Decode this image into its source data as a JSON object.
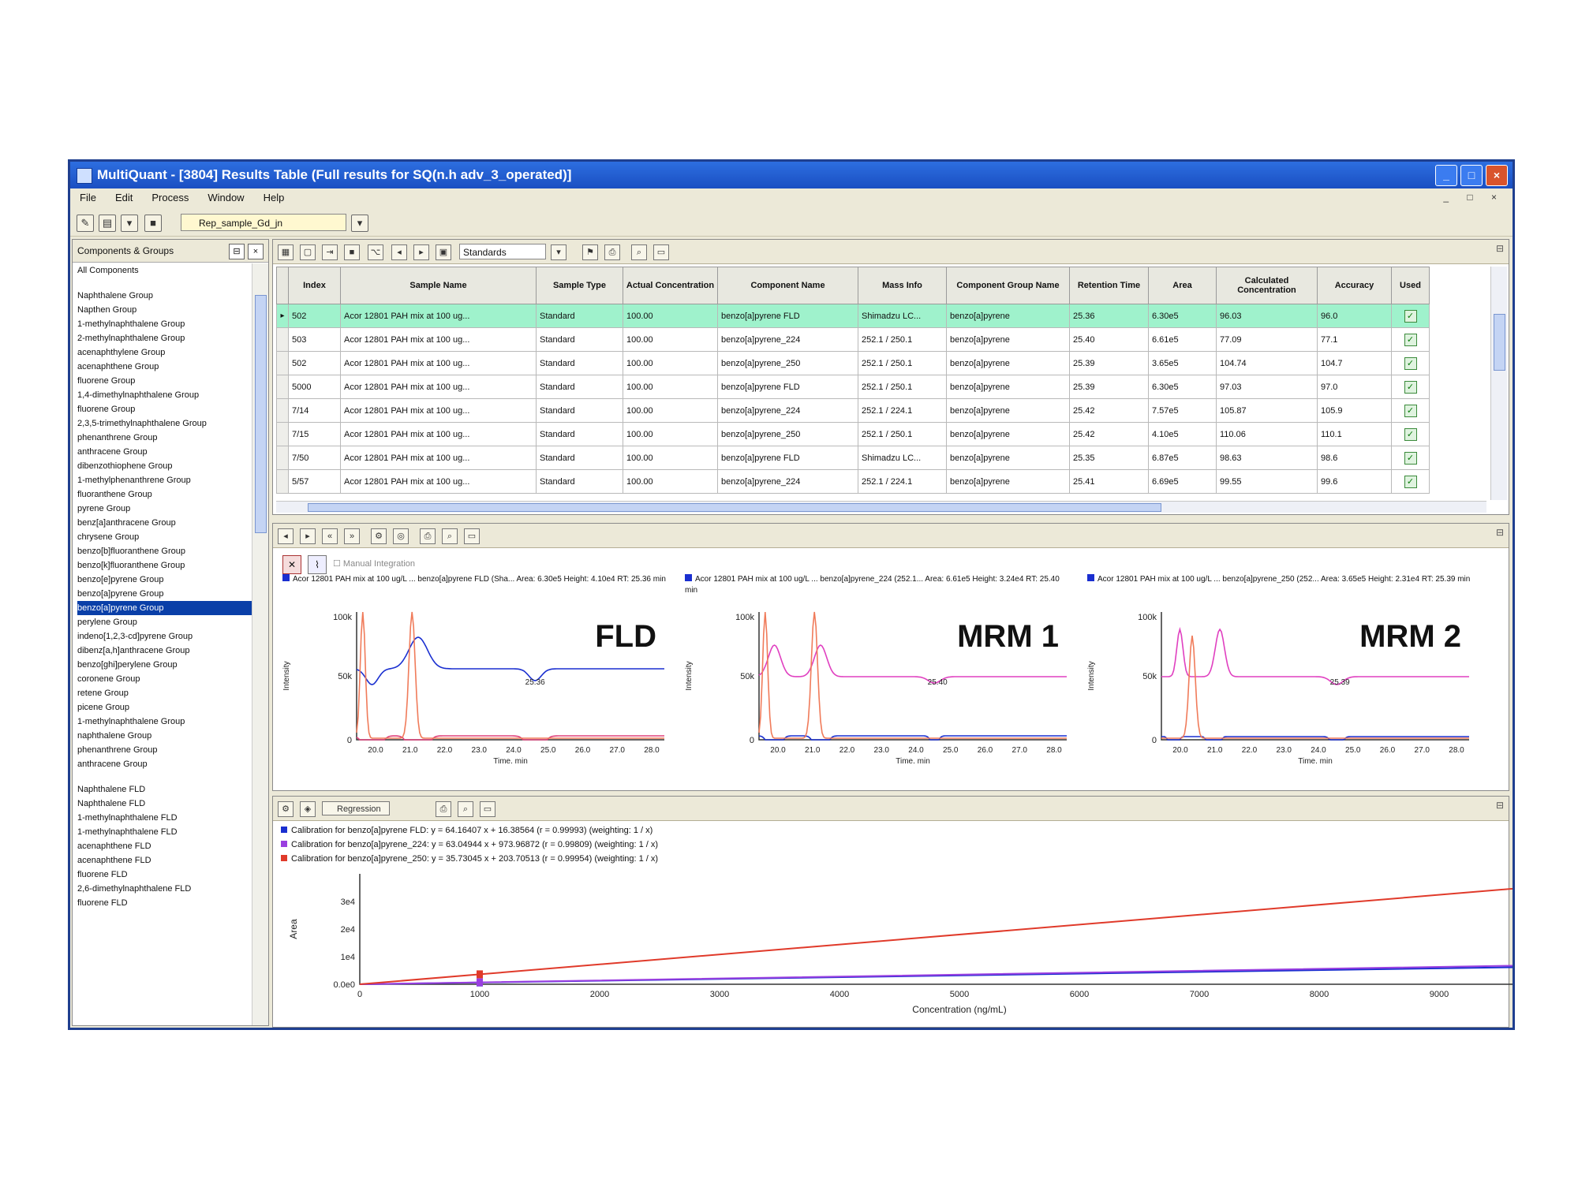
{
  "window": {
    "title": "MultiQuant - [3804] Results Table (Full results for SQ(n.h adv_3_operated)]",
    "min": "_",
    "max": "□",
    "close": "×"
  },
  "menu": [
    "File",
    "Edit",
    "Process",
    "Window",
    "Help"
  ],
  "toolbar": {
    "path": "Rep_sample_Gd_jn"
  },
  "left_pane": {
    "title": "Components & Groups",
    "items_group": [
      "All Components",
      "",
      "Naphthalene Group",
      "Napthen Group",
      "1-methylnaphthalene Group",
      "2-methylnaphthalene Group",
      "acenaphthylene Group",
      "acenaphthene Group",
      "fluorene Group",
      "1,4-dimethylnaphthalene Group",
      "fluorene Group",
      "2,3,5-trimethylnaphthalene Group",
      "phenanthrene Group",
      "anthracene Group",
      "dibenzothiophene Group",
      "1-methylphenanthrene Group",
      "fluoranthene Group",
      "pyrene Group",
      "benz[a]anthracene Group",
      "chrysene Group",
      "benzo[b]fluoranthene Group",
      "benzo[k]fluoranthene Group",
      "benzo[e]pyrene Group",
      "benzo[a]pyrene Group",
      "benzo[a]pyrene Group",
      "perylene Group",
      "indeno[1,2,3-cd]pyrene Group",
      "dibenz[a,h]anthracene Group",
      "benzo[ghi]perylene Group",
      "coronene Group",
      "retene Group",
      "picene Group",
      "1-methylnaphthalene Group",
      "naphthalene Group",
      "phenanthrene Group",
      "anthracene Group"
    ],
    "items_comp": [
      "Naphthalene FLD",
      "Naphthalene FLD",
      "1-methylnaphthalene FLD",
      "1-methylnaphthalene FLD",
      "acenaphthene FLD",
      "acenaphthene FLD",
      "fluorene FLD",
      "2,6-dimethylnaphthalene FLD",
      "fluorene FLD"
    ],
    "selected_index": 24
  },
  "results": {
    "view_label": "Standards",
    "columns": [
      "Index",
      "Sample Name",
      "Sample Type",
      "Actual Concentration",
      "Component Name",
      "Mass Info",
      "Component Group Name",
      "Retention Time",
      "Area",
      "Calculated Concentration",
      "Accuracy",
      "Used"
    ],
    "rows": [
      [
        "502",
        "Acor 12801 PAH mix at 100 ug...",
        "Standard",
        "100.00",
        "benzo[a]pyrene FLD",
        "Shimadzu LC...",
        "benzo[a]pyrene",
        "25.36",
        "6.30e5",
        "96.03",
        "96.0",
        "✓"
      ],
      [
        "503",
        "Acor 12801 PAH mix at 100 ug...",
        "Standard",
        "100.00",
        "benzo[a]pyrene_224",
        "252.1 / 250.1",
        "benzo[a]pyrene",
        "25.40",
        "6.61e5",
        "77.09",
        "77.1",
        "✓"
      ],
      [
        "502",
        "Acor 12801 PAH mix at 100 ug...",
        "Standard",
        "100.00",
        "benzo[a]pyrene_250",
        "252.1 / 250.1",
        "benzo[a]pyrene",
        "25.39",
        "3.65e5",
        "104.74",
        "104.7",
        "✓"
      ],
      [
        "5000",
        "Acor 12801 PAH mix at 100 ug...",
        "Standard",
        "100.00",
        "benzo[a]pyrene FLD",
        "252.1 / 250.1",
        "benzo[a]pyrene",
        "25.39",
        "6.30e5",
        "97.03",
        "97.0",
        "✓"
      ],
      [
        "7/14",
        "Acor 12801 PAH mix at 100 ug...",
        "Standard",
        "100.00",
        "benzo[a]pyrene_224",
        "252.1 / 224.1",
        "benzo[a]pyrene",
        "25.42",
        "7.57e5",
        "105.87",
        "105.9",
        "✓"
      ],
      [
        "7/15",
        "Acor 12801 PAH mix at 100 ug...",
        "Standard",
        "100.00",
        "benzo[a]pyrene_250",
        "252.1 / 250.1",
        "benzo[a]pyrene",
        "25.42",
        "4.10e5",
        "110.06",
        "110.1",
        "✓"
      ],
      [
        "7/50",
        "Acor 12801 PAH mix at 100 ug...",
        "Standard",
        "100.00",
        "benzo[a]pyrene FLD",
        "Shimadzu LC...",
        "benzo[a]pyrene",
        "25.35",
        "6.87e5",
        "98.63",
        "98.6",
        "✓"
      ],
      [
        "5/57",
        "Acor 12801 PAH mix at 100 ug...",
        "Standard",
        "100.00",
        "benzo[a]pyrene_224",
        "252.1 / 224.1",
        "benzo[a]pyrene",
        "25.41",
        "6.69e5",
        "99.55",
        "99.6",
        "✓"
      ]
    ],
    "selected_row": 0
  },
  "chromatograms": {
    "manual_integration": "Manual Integration",
    "panels": [
      {
        "label": "FLD",
        "title": "Acor 12801 PAH mix at 100 ug/L ... benzo[a]pyrene FLD (Sha... Area: 6.30e5 Height: 4.10e4 RT: 25.36 min",
        "ytick_top": "100k",
        "ytick_mid": "50k",
        "ytick_zero": "0",
        "xticks": [
          "20.0",
          "21.0",
          "22.0",
          "23.0",
          "24.0",
          "25.0",
          "26.0",
          "27.0",
          "28.0"
        ],
        "xlabel": "Time, min",
        "ylabel": "Intensity",
        "peak_label": "25.36"
      },
      {
        "label": "MRM 1",
        "title": "Acor 12801 PAH mix at 100 ug/L ... benzo[a]pyrene_224 (252.1... Area: 6.61e5 Height: 3.24e4 RT: 25.40 min",
        "ytick_top": "100k",
        "ytick_mid": "50k",
        "ytick_zero": "0",
        "xticks": [
          "20.0",
          "21.0",
          "22.0",
          "23.0",
          "24.0",
          "25.0",
          "26.0",
          "27.0",
          "28.0"
        ],
        "xlabel": "Time, min",
        "ylabel": "Intensity",
        "peak_label": "25.40"
      },
      {
        "label": "MRM 2",
        "title": "Acor 12801 PAH mix at 100 ug/L ... benzo[a]pyrene_250 (252... Area: 3.65e5 Height: 2.31e4 RT: 25.39 min",
        "ytick_top": "100k",
        "ytick_mid": "50k",
        "ytick_zero": "0",
        "xticks": [
          "20.0",
          "21.0",
          "22.0",
          "23.0",
          "24.0",
          "25.0",
          "26.0",
          "27.0",
          "28.0"
        ],
        "xlabel": "Time, min",
        "ylabel": "Intensity",
        "peak_label": "25.39"
      }
    ]
  },
  "calibration": {
    "regression_label": "Regression",
    "legend": [
      {
        "text": "Calibration for benzo[a]pyrene FLD: y = 64.16407 x + 16.38564 (r = 0.99993) (weighting: 1 / x)",
        "color": "#1a2fd0"
      },
      {
        "text": "Calibration for benzo[a]pyrene_224: y = 63.04944 x + 973.96872 (r = 0.99809) (weighting: 1 / x)",
        "color": "#9a3fe0"
      },
      {
        "text": "Calibration for benzo[a]pyrene_250: y = 35.73045 x + 203.70513 (r = 0.99954) (weighting: 1 / x)",
        "color": "#e03a2a"
      }
    ],
    "yticks": [
      "0.0e0",
      "1e4",
      "2e4",
      "3e4"
    ],
    "xticks": [
      "0",
      "1000",
      "2000",
      "3000",
      "4000",
      "5000",
      "6000",
      "7000",
      "8000",
      "9000"
    ],
    "xlabel": "Concentration (ng/mL)",
    "ylabel": "Area"
  },
  "chart_data": {
    "type": "line",
    "xlabel": "Concentration (ng/mL)",
    "ylabel": "Area",
    "xlim": [
      0,
      10000
    ],
    "ylim": [
      0,
      40000
    ],
    "series": [
      {
        "name": "benzo[a]pyrene FLD",
        "x": [
          0,
          1000,
          10000
        ],
        "y": [
          0,
          640,
          6400
        ]
      },
      {
        "name": "benzo[a]pyrene_224",
        "x": [
          0,
          1000,
          10000
        ],
        "y": [
          0,
          700,
          7000
        ]
      },
      {
        "name": "benzo[a]pyrene_250",
        "x": [
          0,
          1000,
          10000
        ],
        "y": [
          0,
          3600,
          36000
        ]
      }
    ]
  }
}
